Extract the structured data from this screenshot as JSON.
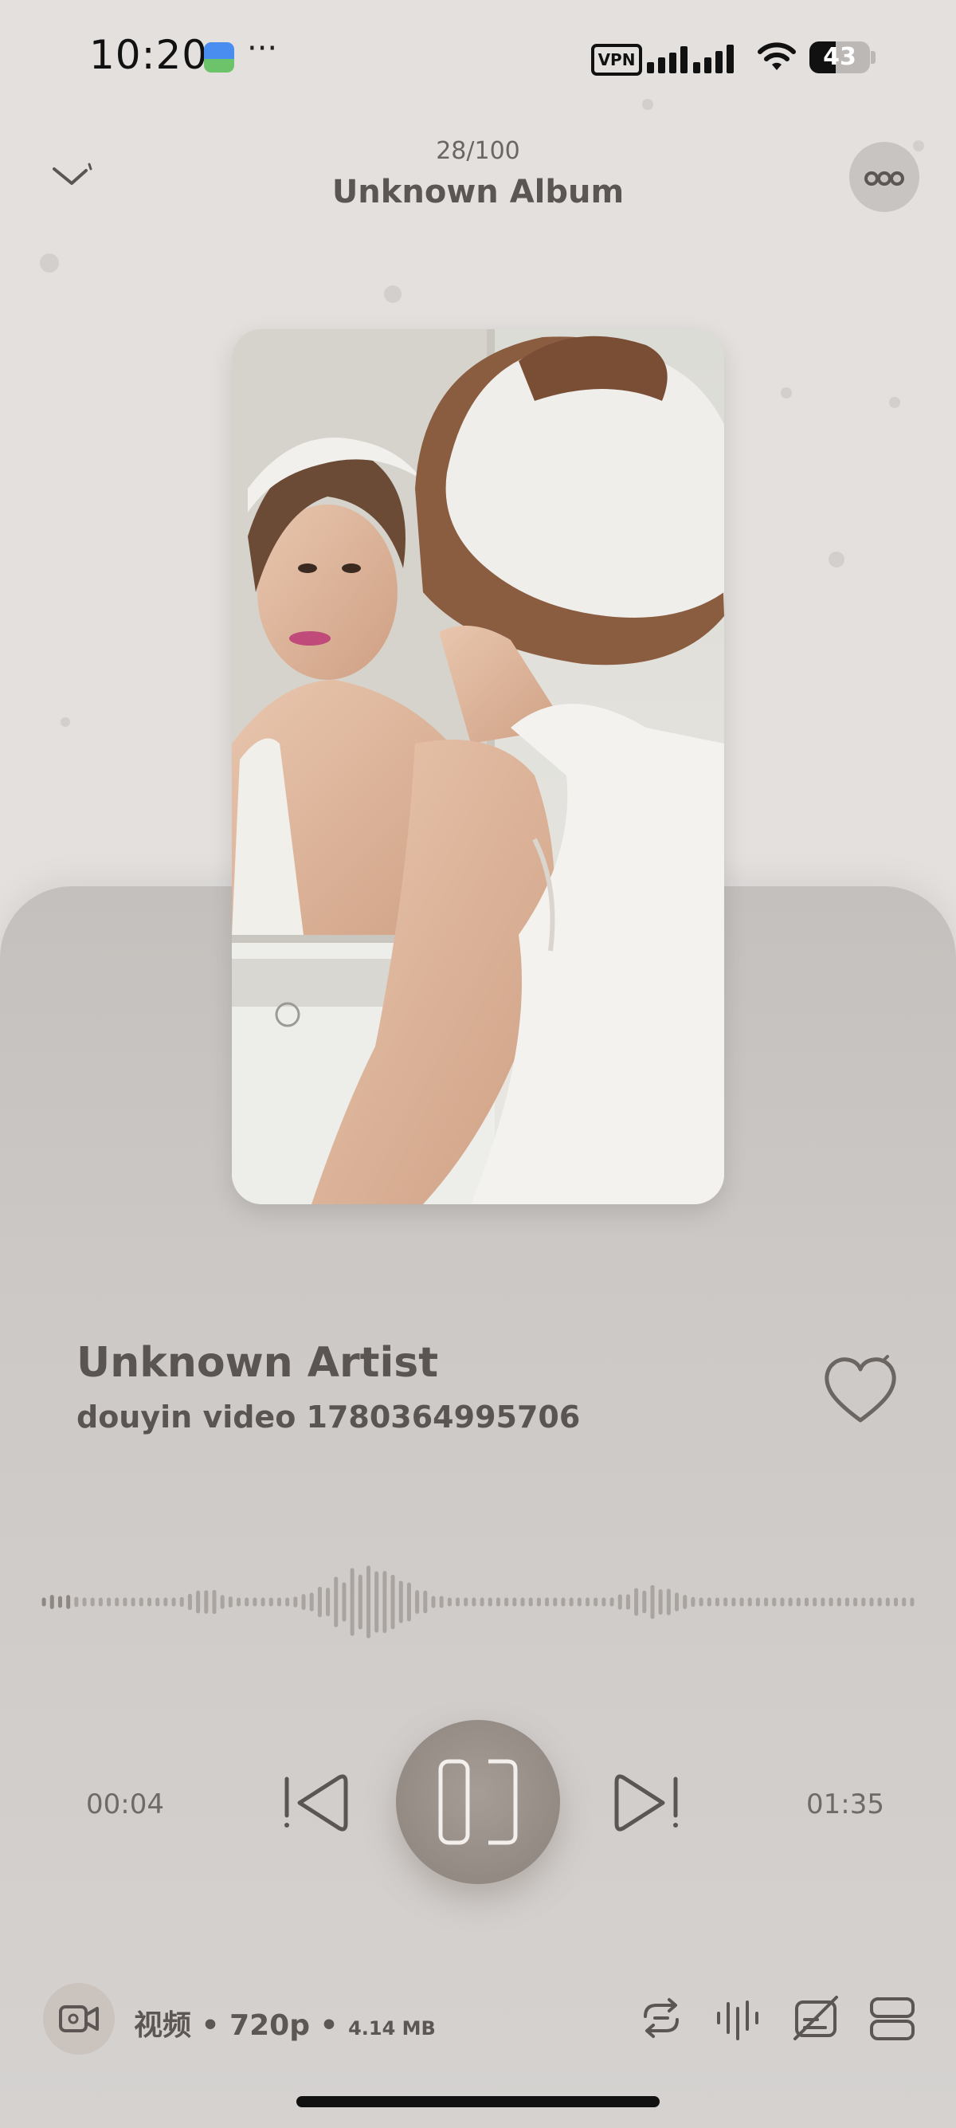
{
  "status_bar": {
    "time": "10:20",
    "overflow": "···",
    "vpn": "VPN",
    "battery": "43",
    "battery_level": 0.43
  },
  "header": {
    "track_count": "28/100",
    "album": "Unknown Album"
  },
  "track": {
    "artist": "Unknown Artist",
    "title": "douyin video 1780364995706",
    "liked": false
  },
  "player": {
    "elapsed": "00:04",
    "total": "01:35",
    "state": "playing"
  },
  "bottom_bar": {
    "format": "视频 • 720p • ",
    "size": "4.14 MB"
  },
  "colors": {
    "background": "#e3e0de",
    "panel": "#cdc9c7",
    "accent": "#948a84",
    "text": "#5a5552"
  },
  "icons": [
    "collapse-chevron-icon",
    "more-icon",
    "heart-icon",
    "previous-icon",
    "pause-icon",
    "next-icon",
    "video-icon",
    "repeat-icon",
    "equalizer-icon",
    "lyrics-off-icon",
    "playlist-icon"
  ]
}
